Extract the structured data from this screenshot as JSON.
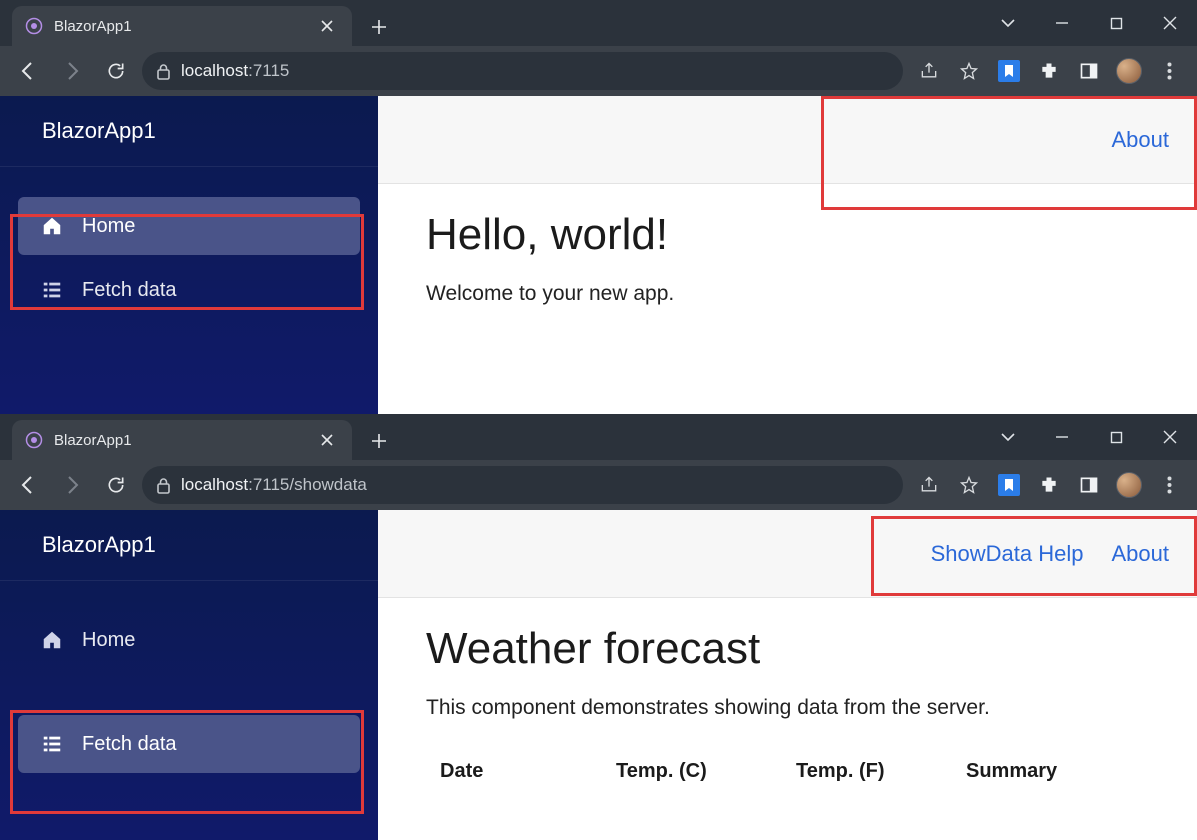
{
  "windows": [
    {
      "tab_title": "BlazorApp1",
      "url_host": "localhost",
      "url_port": ":7115",
      "url_path": "",
      "sidebar": {
        "brand": "BlazorApp1",
        "items": [
          {
            "label": "Home",
            "active": true
          },
          {
            "label": "Fetch data",
            "active": false
          }
        ]
      },
      "top_links": [
        "About"
      ],
      "page": {
        "heading": "Hello, world!",
        "subtext": "Welcome to your new app."
      }
    },
    {
      "tab_title": "BlazorApp1",
      "url_host": "localhost",
      "url_port": ":7115",
      "url_path": "/showdata",
      "sidebar": {
        "brand": "BlazorApp1",
        "items": [
          {
            "label": "Home",
            "active": false
          },
          {
            "label": "Fetch data",
            "active": true
          }
        ]
      },
      "top_links": [
        "ShowData Help",
        "About"
      ],
      "page": {
        "heading": "Weather forecast",
        "subtext": "This component demonstrates showing data from the server.",
        "columns": [
          "Date",
          "Temp. (C)",
          "Temp. (F)",
          "Summary"
        ]
      }
    }
  ]
}
